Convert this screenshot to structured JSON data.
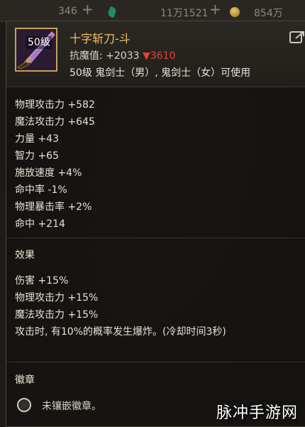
{
  "topbar": {
    "currency1": "346",
    "currency2": "11万1521",
    "currency3": "854万"
  },
  "item": {
    "level_badge": "50级",
    "name": "十字斩刀-斗",
    "resist_label": "抗魔值: +2033",
    "resist_arrow": "▼",
    "resist_value": "3610",
    "usable": "50级 鬼剑士（男）, 鬼剑士（女）可使用"
  },
  "stats": [
    "物理攻击力 +582",
    "魔法攻击力 +645",
    "力量 +43",
    "智力 +65",
    "施放速度 +4%",
    "命中率 -1%",
    "物理暴击率 +2%",
    "命中 +214"
  ],
  "effects": {
    "title": "效果",
    "lines": [
      "伤害 +15%",
      "物理攻击力 +15%",
      "魔法攻击力 +15%",
      "攻击时, 有10%的概率发生爆炸。(冷却时间3秒)"
    ]
  },
  "emblem": {
    "title": "徽章",
    "slot_text": "未镶嵌徽章。"
  },
  "watermark": "脉冲手游网",
  "colors": {
    "item_name": "#f1c36a",
    "resist_down": "#e2413b",
    "frame_border": "#c5a259"
  },
  "icons": {
    "share": "share-icon",
    "gem": "gem-icon",
    "coin": "coin-icon",
    "weapon": "katana-icon",
    "emblem_slot": "emblem-slot-icon"
  }
}
